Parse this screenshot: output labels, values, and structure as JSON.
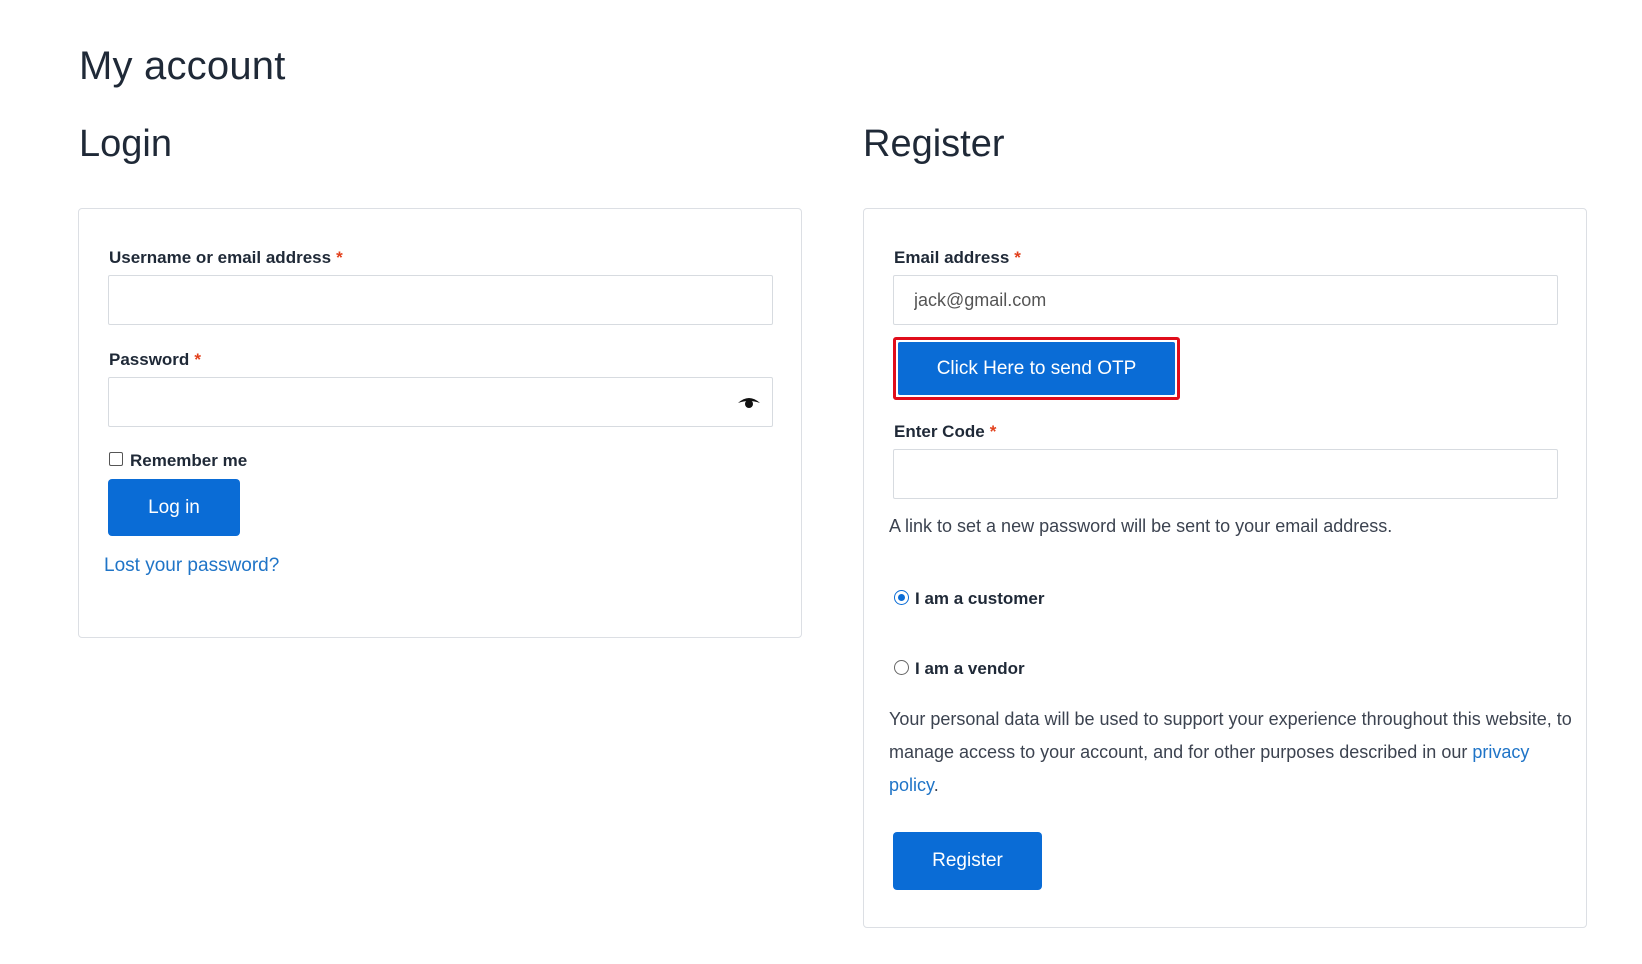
{
  "page": {
    "title": "My account"
  },
  "login": {
    "heading": "Login",
    "username_label": "Username or email address",
    "username_value": "",
    "password_label": "Password",
    "password_value": "",
    "required_mark": "*",
    "remember_label": "Remember me",
    "remember_checked": false,
    "login_button": "Log in",
    "lost_password_link": "Lost your password?"
  },
  "register": {
    "heading": "Register",
    "email_label": "Email address",
    "email_value": "jack@gmail.com",
    "required_mark": "*",
    "otp_button": "Click Here to send OTP",
    "code_label": "Enter Code",
    "code_value": "",
    "password_notice": "A link to set a new password will be sent to your email address.",
    "role_options": [
      {
        "label": "I am a customer",
        "selected": true
      },
      {
        "label": "I am a vendor",
        "selected": false
      }
    ],
    "privacy_text": "Your personal data will be used to support your experience throughout this website, to manage access to your account, and for other purposes described in our",
    "privacy_link": "privacy policy",
    "privacy_end": ".",
    "register_button": "Register"
  },
  "colors": {
    "primary": "#0a6cd6",
    "required": "#e2401c",
    "link": "#1f74c7",
    "highlight_frame": "#e00d1b"
  },
  "icons": {
    "password_toggle": "eye-icon"
  }
}
